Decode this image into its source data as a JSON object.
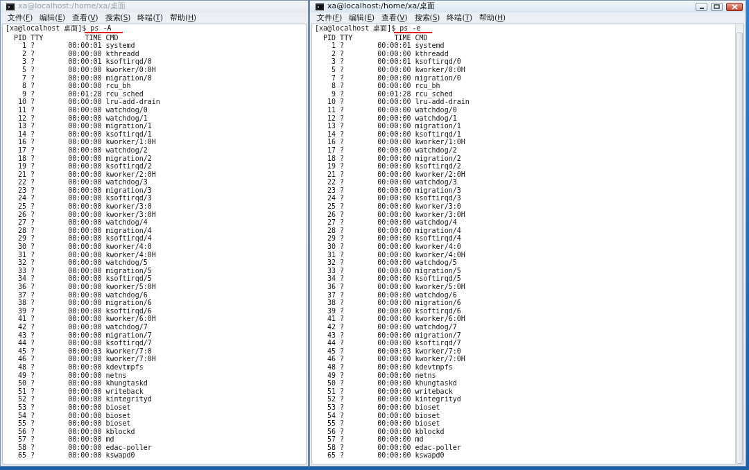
{
  "windows": [
    {
      "title": "xa@localhost:/home/xa/桌面",
      "active": false,
      "menu": [
        "文件(F)",
        "编辑(E)",
        "查看(V)",
        "搜索(S)",
        "终端(T)",
        "帮助(H)"
      ],
      "terminal": {
        "prompt": "[xa@localhost 桌面]$ ps -A",
        "underlined": true,
        "header": "  PID TTY          TIME CMD",
        "lines": [
          "    1 ?        00:00:01 systemd",
          "    2 ?        00:00:00 kthreadd",
          "    3 ?        00:00:01 ksoftirqd/0",
          "    5 ?        00:00:00 kworker/0:0H",
          "    7 ?        00:00:00 migration/0",
          "    8 ?        00:00:00 rcu_bh",
          "    9 ?        00:01:28 rcu_sched",
          "   10 ?        00:00:00 lru-add-drain",
          "   11 ?        00:00:00 watchdog/0",
          "   12 ?        00:00:00 watchdog/1",
          "   13 ?        00:00:00 migration/1",
          "   14 ?        00:00:00 ksoftirqd/1",
          "   16 ?        00:00:00 kworker/1:0H",
          "   17 ?        00:00:00 watchdog/2",
          "   18 ?        00:00:00 migration/2",
          "   19 ?        00:00:00 ksoftirqd/2",
          "   21 ?        00:00:00 kworker/2:0H",
          "   22 ?        00:00:00 watchdog/3",
          "   23 ?        00:00:00 migration/3",
          "   24 ?        00:00:00 ksoftirqd/3",
          "   25 ?        00:00:00 kworker/3:0",
          "   26 ?        00:00:00 kworker/3:0H",
          "   27 ?        00:00:00 watchdog/4",
          "   28 ?        00:00:00 migration/4",
          "   29 ?        00:00:00 ksoftirqd/4",
          "   30 ?        00:00:00 kworker/4:0",
          "   31 ?        00:00:00 kworker/4:0H",
          "   32 ?        00:00:00 watchdog/5",
          "   33 ?        00:00:00 migration/5",
          "   34 ?        00:00:00 ksoftirqd/5",
          "   36 ?        00:00:00 kworker/5:0H",
          "   37 ?        00:00:00 watchdog/6",
          "   38 ?        00:00:00 migration/6",
          "   39 ?        00:00:00 ksoftirqd/6",
          "   41 ?        00:00:00 kworker/6:0H",
          "   42 ?        00:00:00 watchdog/7",
          "   43 ?        00:00:00 migration/7",
          "   44 ?        00:00:00 ksoftirqd/7",
          "   45 ?        00:00:03 kworker/7:0",
          "   46 ?        00:00:00 kworker/7:0H",
          "   48 ?        00:00:00 kdevtmpfs",
          "   49 ?        00:00:00 netns",
          "   50 ?        00:00:00 khungtaskd",
          "   51 ?        00:00:00 writeback",
          "   52 ?        00:00:00 kintegrityd",
          "   53 ?        00:00:00 bioset",
          "   54 ?        00:00:00 bioset",
          "   55 ?        00:00:00 bioset",
          "   56 ?        00:00:00 kblockd",
          "   57 ?        00:00:00 md",
          "   58 ?        00:00:00 edac-poller",
          "   65 ?        00:00:00 kswapd0"
        ]
      }
    },
    {
      "title": "xa@localhost:/home/xa/桌面",
      "active": true,
      "menu": [
        "文件(F)",
        "编辑(E)",
        "查看(V)",
        "搜索(S)",
        "终端(T)",
        "帮助(H)"
      ],
      "terminal": {
        "prompt": "[xa@localhost 桌面]$ ps -e",
        "underlined": true,
        "header": "  PID TTY          TIME CMD",
        "lines": [
          "    1 ?        00:00:01 systemd",
          "    2 ?        00:00:00 kthreadd",
          "    3 ?        00:00:01 ksoftirqd/0",
          "    5 ?        00:00:00 kworker/0:0H",
          "    7 ?        00:00:00 migration/0",
          "    8 ?        00:00:00 rcu_bh",
          "    9 ?        00:01:28 rcu_sched",
          "   10 ?        00:00:00 lru-add-drain",
          "   11 ?        00:00:00 watchdog/0",
          "   12 ?        00:00:00 watchdog/1",
          "   13 ?        00:00:00 migration/1",
          "   14 ?        00:00:00 ksoftirqd/1",
          "   16 ?        00:00:00 kworker/1:0H",
          "   17 ?        00:00:00 watchdog/2",
          "   18 ?        00:00:00 migration/2",
          "   19 ?        00:00:00 ksoftirqd/2",
          "   21 ?        00:00:00 kworker/2:0H",
          "   22 ?        00:00:00 watchdog/3",
          "   23 ?        00:00:00 migration/3",
          "   24 ?        00:00:00 ksoftirqd/3",
          "   25 ?        00:00:00 kworker/3:0",
          "   26 ?        00:00:00 kworker/3:0H",
          "   27 ?        00:00:00 watchdog/4",
          "   28 ?        00:00:00 migration/4",
          "   29 ?        00:00:00 ksoftirqd/4",
          "   30 ?        00:00:00 kworker/4:0",
          "   31 ?        00:00:00 kworker/4:0H",
          "   32 ?        00:00:00 watchdog/5",
          "   33 ?        00:00:00 migration/5",
          "   34 ?        00:00:00 ksoftirqd/5",
          "   36 ?        00:00:00 kworker/5:0H",
          "   37 ?        00:00:00 watchdog/6",
          "   38 ?        00:00:00 migration/6",
          "   39 ?        00:00:00 ksoftirqd/6",
          "   41 ?        00:00:00 kworker/6:0H",
          "   42 ?        00:00:00 watchdog/7",
          "   43 ?        00:00:00 migration/7",
          "   44 ?        00:00:00 ksoftirqd/7",
          "   45 ?        00:00:03 kworker/7:0",
          "   46 ?        00:00:00 kworker/7:0H",
          "   48 ?        00:00:00 kdevtmpfs",
          "   49 ?        00:00:00 netns",
          "   50 ?        00:00:00 khungtaskd",
          "   51 ?        00:00:00 writeback",
          "   52 ?        00:00:00 kintegrityd",
          "   53 ?        00:00:00 bioset",
          "   54 ?        00:00:00 bioset",
          "   55 ?        00:00:00 bioset",
          "   56 ?        00:00:00 kblockd",
          "   57 ?        00:00:00 md",
          "   58 ?        00:00:00 edac-poller",
          "   65 ?        00:00:00 kswapd0"
        ]
      }
    }
  ]
}
